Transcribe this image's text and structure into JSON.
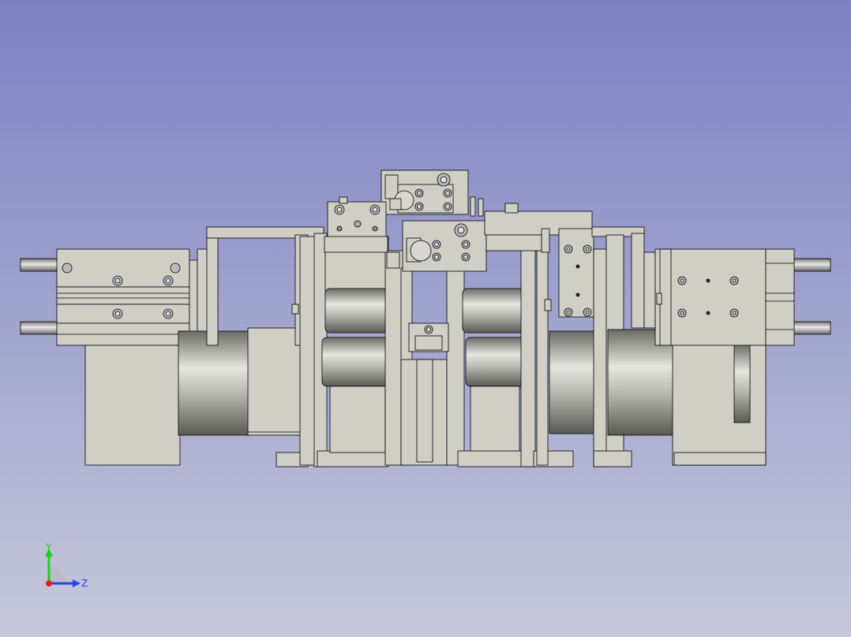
{
  "viewer": {
    "background_top": "#7f7fc2",
    "background_bottom": "#c6c8d9",
    "part_color": "#cfcfc6",
    "edge_color": "#000000"
  },
  "axes": {
    "y_label": "Y",
    "z_label": "Z",
    "x_color": "#e02020",
    "y_color": "#22cc22",
    "z_color": "#2244ee"
  }
}
